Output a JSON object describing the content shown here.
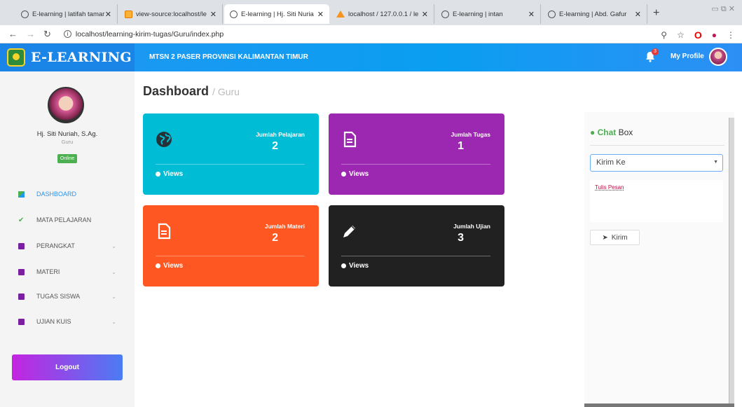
{
  "browser": {
    "tabs": [
      {
        "title": "E-learning | latifah tamar",
        "icon": "globe-icon"
      },
      {
        "title": "view-source:localhost/le",
        "icon": "source-icon"
      },
      {
        "title": "E-learning | Hj. Siti Nuria",
        "icon": "globe-icon"
      },
      {
        "title": "localhost / 127.0.0.1 / le",
        "icon": "phpmyadmin-icon"
      },
      {
        "title": "E-learning | intan",
        "icon": "globe-icon"
      },
      {
        "title": "E-learning | Abd. Gafur",
        "icon": "globe-icon"
      }
    ],
    "url": "localhost/learning-kirim-tugas/Guru/index.php"
  },
  "header": {
    "brand": "E-LEARNING",
    "school": "MTSN 2 PASER PROVINSI KALIMANTAN TIMUR",
    "notif_count": "3",
    "profile_label": "My Profile"
  },
  "sidebar": {
    "user_name": "Hj. Siti Nuriah, S.Ag.",
    "user_role": "Guru",
    "status": "Online",
    "items": [
      {
        "label": "DASHBOARD"
      },
      {
        "label": "MATA PELAJARAN"
      },
      {
        "label": "PERANGKAT"
      },
      {
        "label": "MATERI"
      },
      {
        "label": "TUGAS SISWA"
      },
      {
        "label": "UJIAN KUIS"
      }
    ],
    "logout": "Logout"
  },
  "main": {
    "title": "Dashboard",
    "subtitle": "/ Guru",
    "cards": [
      {
        "label": "Jumlah Pelajaran",
        "value": "2",
        "views": "Views",
        "color": "#00bcd4"
      },
      {
        "label": "Jumlah Tugas",
        "value": "1",
        "views": "Views",
        "color": "#9c27b0"
      },
      {
        "label": "Jumlah Materi",
        "value": "2",
        "views": "Views",
        "color": "#ff5722"
      },
      {
        "label": "Jumlah Ujian",
        "value": "3",
        "views": "Views",
        "color": "#212121"
      }
    ]
  },
  "chat": {
    "title_green": "Chat",
    "title_rest": "Box",
    "select_value": "Kirim Ke",
    "textarea_placeholder": "Tulis Pesan",
    "send_label": "Kirim"
  }
}
